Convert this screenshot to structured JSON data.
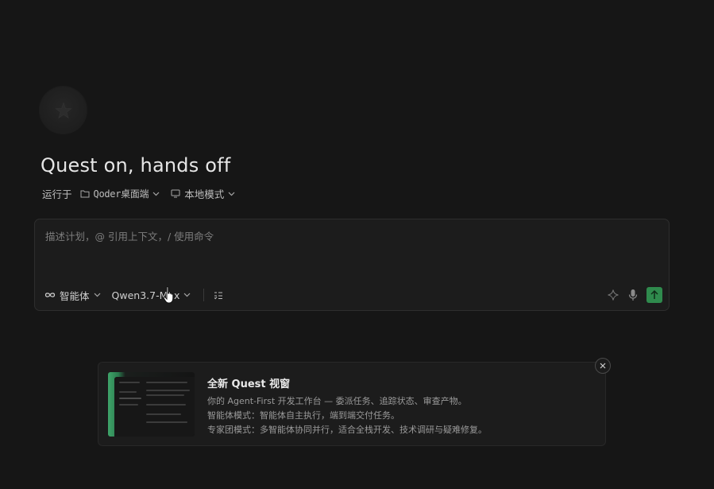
{
  "hero": {
    "title": "Quest on, hands off"
  },
  "run_context": {
    "label": "运行于",
    "folder": "Qoder桌面端",
    "mode": "本地模式"
  },
  "composer": {
    "placeholder": "描述计划，@ 引用上下文，/ 使用命令",
    "agent_mode": "智能体",
    "model": "Qwen3.7-Max"
  },
  "banner": {
    "title": "全新 Quest 视窗",
    "lines": [
      "你的 Agent-First 开发工作台 — 委派任务、追踪状态、审查产物。",
      "智能体模式：智能体自主执行，端到端交付任务。",
      "专家团模式：多智能体协同并行，适合全栈开发、技术调研与疑难修复。"
    ]
  },
  "colors": {
    "background": "#161616",
    "send_button": "#2f8a4d",
    "thumbnail_accent": "#3fa56a"
  },
  "icons": {
    "logo": "quest-logo-icon",
    "folder": "folder-icon",
    "monitor": "monitor-icon",
    "infinity": "infinity-icon",
    "chevron": "chevron-down-icon",
    "tasks": "task-list-icon",
    "sparkle": "sparkle-icon",
    "mic": "microphone-icon",
    "send": "arrow-up-icon",
    "close": "close-icon",
    "cursor": "hand-pointer-cursor-icon"
  }
}
